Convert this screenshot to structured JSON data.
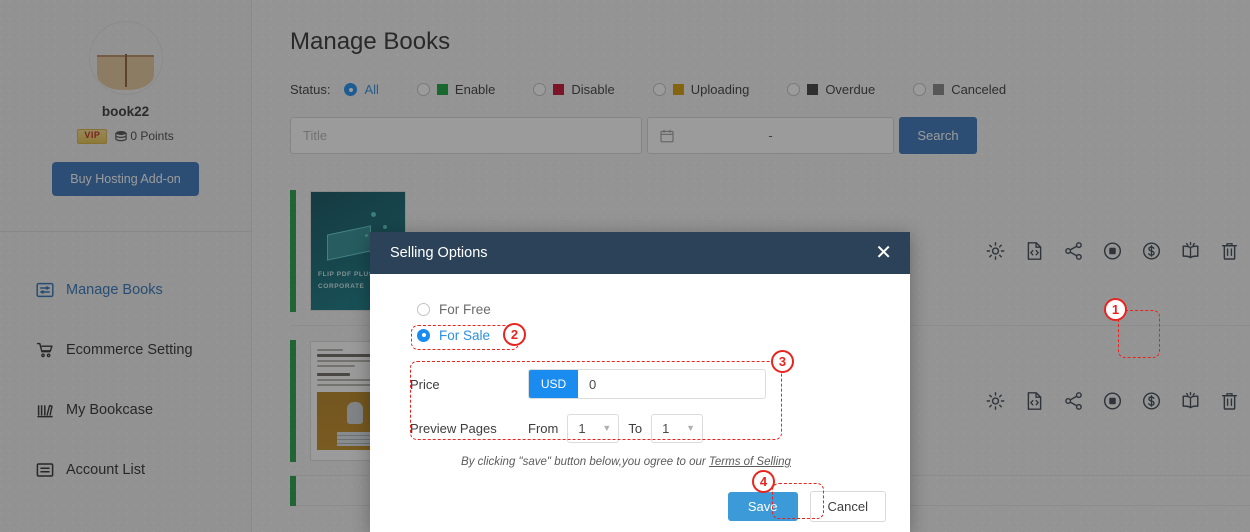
{
  "sidebar": {
    "profile": {
      "avatar_icon": "book-avatar",
      "username": "book22",
      "vip_label": "VIP",
      "points_icon": "coins-icon",
      "points": "0 Points",
      "hosting_button": "Buy Hosting Add-on"
    },
    "items": [
      {
        "label": "Manage Books",
        "icon": "manage-books-icon",
        "active": true
      },
      {
        "label": "Ecommerce Setting",
        "icon": "cart-icon",
        "active": false
      },
      {
        "label": "My Bookcase",
        "icon": "bookcase-icon",
        "active": false
      },
      {
        "label": "Account List",
        "icon": "account-list-icon",
        "active": false
      }
    ]
  },
  "main": {
    "page_title": "Manage Books",
    "status": {
      "label": "Status:",
      "options": [
        {
          "label": "All",
          "color": "",
          "selected": true
        },
        {
          "label": "Enable",
          "color": "#13a33c",
          "selected": false
        },
        {
          "label": "Disable",
          "color": "#c80c2e",
          "selected": false
        },
        {
          "label": "Uploading",
          "color": "#d79b00",
          "selected": false
        },
        {
          "label": "Overdue",
          "color": "#3b3b3b",
          "selected": false
        },
        {
          "label": "Canceled",
          "color": "#848484",
          "selected": false
        }
      ]
    },
    "search": {
      "title_placeholder": "Title",
      "calendar_icon": "calendar-icon",
      "date_separator": "-",
      "search_button": "Search"
    },
    "books": [
      {
        "status_color": "#1f9d42",
        "cover_title_line1": "FLIP PDF PLUS",
        "cover_title_line2": "CORPORATE",
        "actions": [
          "gear-icon",
          "code-file-icon",
          "share-icon",
          "record-icon",
          "dollar-circle-icon",
          "open-book-icon",
          "trash-icon"
        ]
      },
      {
        "status_color": "#1f9d42",
        "cover_title_line1": "",
        "cover_title_line2": "",
        "actions": [
          "gear-icon",
          "code-file-icon",
          "share-icon",
          "record-icon",
          "dollar-circle-icon",
          "open-book-icon",
          "trash-icon"
        ]
      }
    ]
  },
  "modal": {
    "title": "Selling Options",
    "close_icon": "close-icon",
    "options": [
      {
        "label": "For Free",
        "selected": false
      },
      {
        "label": "For Sale",
        "selected": true
      }
    ],
    "price": {
      "label": "Price",
      "currency": "USD",
      "value": "0"
    },
    "preview_pages": {
      "label": "Preview Pages",
      "from_label": "From",
      "from_value": "1",
      "to_label": "To",
      "to_value": "1"
    },
    "terms_prefix": "By clicking \"save\" button below,you ogree to our ",
    "terms_link": "Terms of Selling",
    "save_label": "Save",
    "cancel_label": "Cancel"
  },
  "annotations": [
    {
      "number": "1"
    },
    {
      "number": "2"
    },
    {
      "number": "3"
    },
    {
      "number": "4"
    }
  ],
  "colors": {
    "accent_blue": "#1a8cf0",
    "brand_blue": "#3573b9",
    "modal_header": "#2c4258",
    "annotation_red": "#e8241f",
    "save_blue": "#3d9ad8"
  }
}
